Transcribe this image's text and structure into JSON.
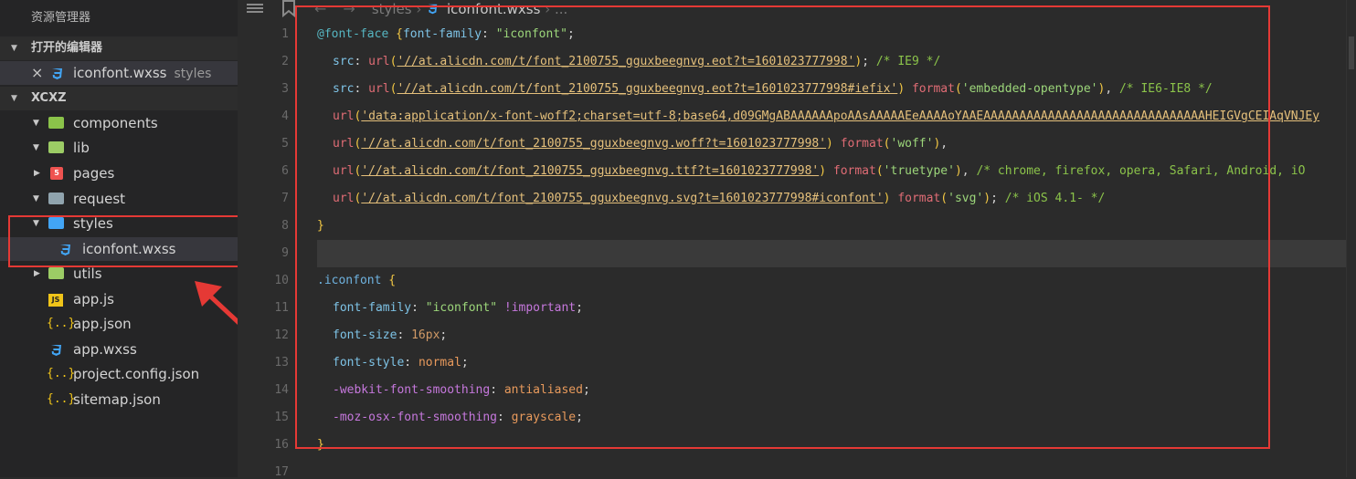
{
  "sidebar": {
    "title": "资源管理器",
    "open_editors": {
      "header": "打开的编辑器",
      "items": [
        {
          "name": "iconfont.wxss",
          "hint": "styles"
        }
      ]
    },
    "project": {
      "header": "XCXZ",
      "items": [
        {
          "name": "components"
        },
        {
          "name": "lib"
        },
        {
          "name": "pages"
        },
        {
          "name": "request"
        },
        {
          "name": "styles"
        },
        {
          "name": "iconfont.wxss"
        },
        {
          "name": "utils"
        },
        {
          "name": "app.js"
        },
        {
          "name": "app.json"
        },
        {
          "name": "app.wxss"
        },
        {
          "name": "project.config.json"
        },
        {
          "name": "sitemap.json"
        }
      ]
    }
  },
  "editor": {
    "breadcrumb": {
      "folder": "styles",
      "file": "iconfont.wxss",
      "more": "..."
    },
    "line_numbers": [
      "1",
      "2",
      "3",
      "4",
      "5",
      "6",
      "7",
      "8",
      "9",
      "10",
      "11",
      "12",
      "13",
      "14",
      "15",
      "16",
      "17"
    ],
    "code": {
      "l1": {
        "at": "@font-face",
        "brace": "{",
        "prop": "font-family",
        "colon": ":",
        "str": "\"iconfont\"",
        "semi": ";"
      },
      "l2": {
        "prop": "src",
        "fn": "url",
        "url": "'//at.alicdn.com/t/font_2100755_gguxbeegnvg.eot?t=1601023777998'",
        "tail": ";",
        "comment": "/* IE9 */"
      },
      "l3": {
        "prop": "src",
        "fn": "url",
        "url": "'//at.alicdn.com/t/font_2100755_gguxbeegnvg.eot?t=1601023777998#iefix'",
        "fn2": "format",
        "arg": "'embedded-opentype'",
        "tail": ",",
        "comment": "/* IE6-IE8 */"
      },
      "l4": {
        "fn": "url",
        "url": "'data:application/x-font-woff2;charset=utf-8;base64,d09GMgABAAAAAApoAAsAAAAAEeAAAAoYAAEAAAAAAAAAAAAAAAAAAAAAAAAAAAAAAAHEIGVgCEIAqVNJEy"
      },
      "l5": {
        "fn": "url",
        "url": "'//at.alicdn.com/t/font_2100755_gguxbeegnvg.woff?t=1601023777998'",
        "fn2": "format",
        "arg": "'woff'",
        "tail": ","
      },
      "l6": {
        "fn": "url",
        "url": "'//at.alicdn.com/t/font_2100755_gguxbeegnvg.ttf?t=1601023777998'",
        "fn2": "format",
        "arg": "'truetype'",
        "tail": ",",
        "comment": "/* chrome, firefox, opera, Safari, Android, iO"
      },
      "l7": {
        "fn": "url",
        "url": "'//at.alicdn.com/t/font_2100755_gguxbeegnvg.svg?t=1601023777998#iconfont'",
        "fn2": "format",
        "arg": "'svg'",
        "tail": ";",
        "comment": "/* iOS 4.1- */"
      },
      "l8": {
        "brace": "}"
      },
      "l10": {
        "selector": ".iconfont",
        "brace": "{"
      },
      "l11": {
        "prop": "font-family",
        "str": "\"iconfont\"",
        "imp": "!important",
        "semi": ";"
      },
      "l12": {
        "prop": "font-size",
        "val": "16px",
        "semi": ";"
      },
      "l13": {
        "prop": "font-style",
        "val": "normal",
        "semi": ";"
      },
      "l14": {
        "prop": "-webkit-font-smoothing",
        "val": "antialiased",
        "semi": ";"
      },
      "l15": {
        "prop": "-moz-osx-font-smoothing",
        "val": "grayscale",
        "semi": ";"
      },
      "l16": {
        "brace": "}"
      }
    }
  },
  "colors": {
    "highlight": "#e53935",
    "background": "#2b2b2b",
    "sidebar": "#252526"
  },
  "icons": [
    "folder-icon",
    "css3-file-icon",
    "js-file-icon",
    "json-file-icon",
    "close-icon",
    "back-arrow-icon",
    "forward-arrow-icon",
    "list-icon",
    "bookmark-icon"
  ]
}
